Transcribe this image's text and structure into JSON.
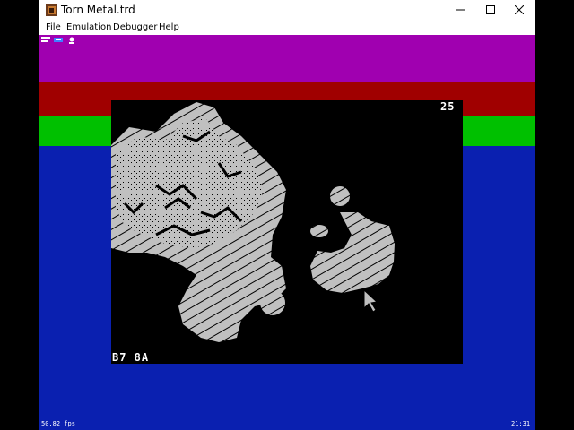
{
  "window": {
    "title": "Torn Metal.trd",
    "buttons": [
      "minimize",
      "maximize",
      "close"
    ]
  },
  "menu": {
    "items": [
      "File",
      "Emulation",
      "Debugger",
      "Help"
    ]
  },
  "emulator": {
    "border_colors": {
      "magenta": "#a000b0",
      "red": "#a00000",
      "green": "#00c000",
      "blue": "#0a20b0"
    },
    "screen": {
      "score": "25",
      "coords": "B7 8A",
      "terrain_color": "#c0c0c0"
    },
    "status": {
      "fps": "50.82 fps",
      "time": "21:31"
    },
    "toolbar_icons": [
      "keyboard-icon",
      "tape-icon",
      "joystick-icon"
    ]
  }
}
